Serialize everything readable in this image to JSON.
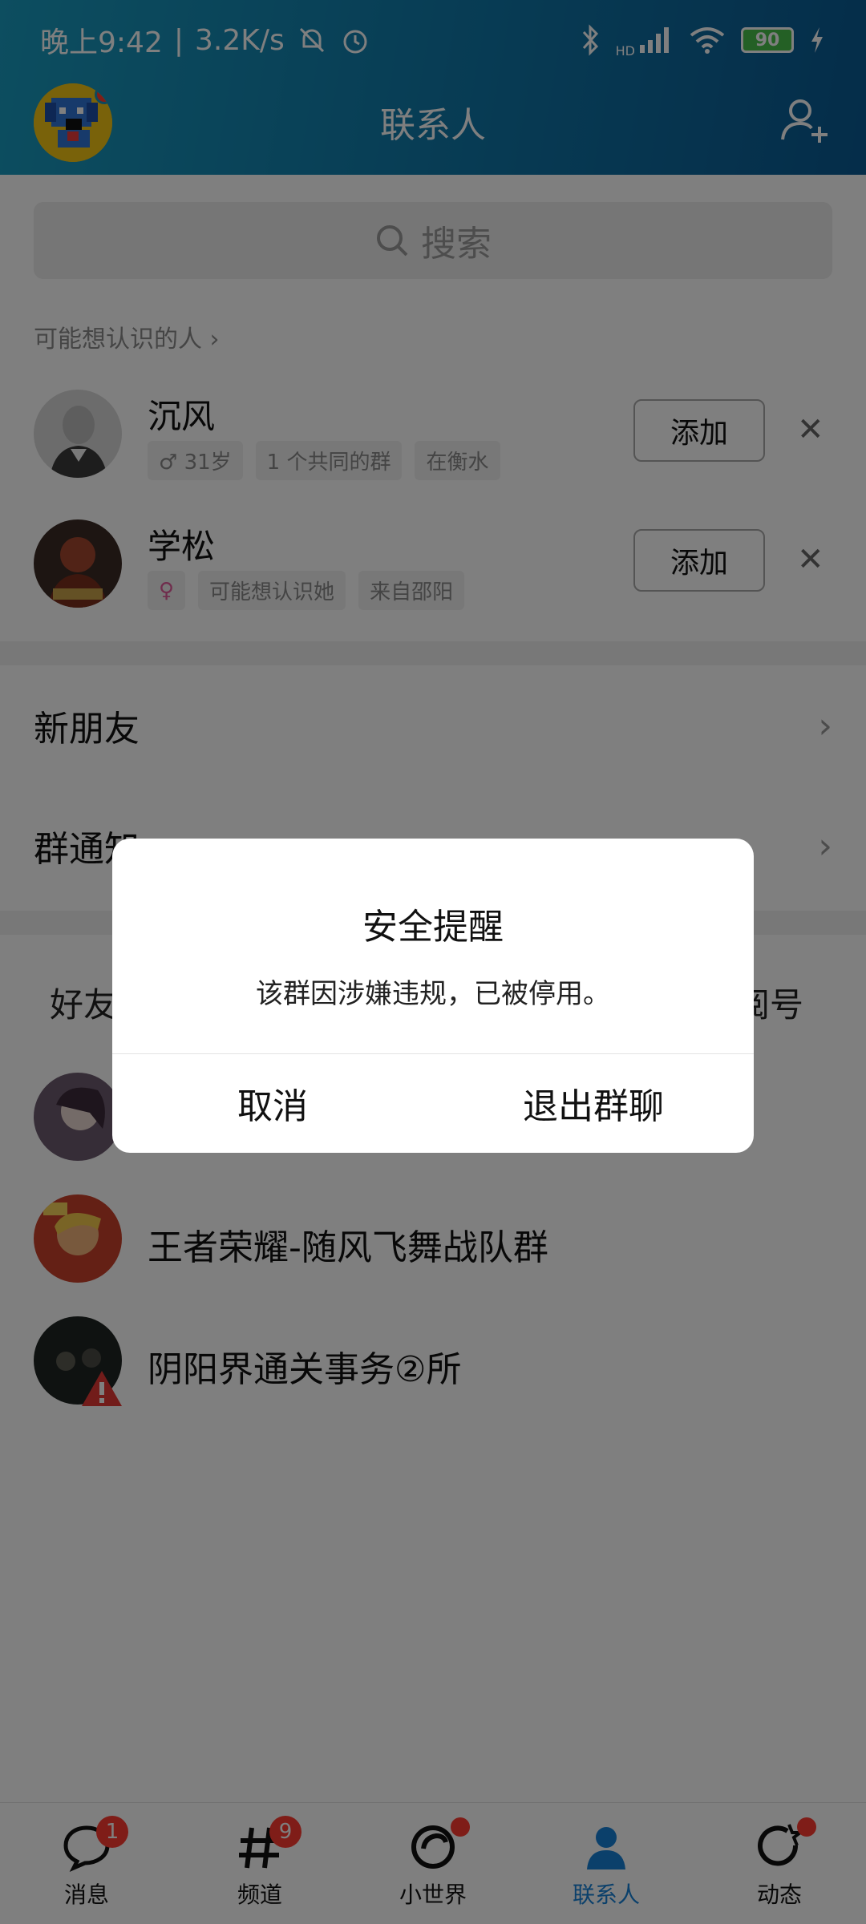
{
  "status_bar": {
    "time": "晚上9:42",
    "separator": "|",
    "net_speed": "3.2K/s",
    "battery": "90",
    "signal_label": "HD"
  },
  "header": {
    "title": "联系人"
  },
  "search": {
    "placeholder": "搜索"
  },
  "suggest": {
    "heading": "可能想认识的人",
    "people": [
      {
        "name": "沉风",
        "tags": [
          "♂ 31岁",
          "1 个共同的群",
          "在衡水"
        ],
        "button": "添加"
      },
      {
        "name": "学松",
        "tags": [
          "♀",
          "可能想认识她",
          "来自邵阳"
        ],
        "button": "添加"
      }
    ]
  },
  "rows": {
    "new_friends": "新朋友",
    "group_notice": "群通知"
  },
  "tabs": {
    "friends": "好友",
    "right_partial": "阅号"
  },
  "groups": [
    {
      "name": ""
    },
    {
      "name": "王者荣耀-随风飞舞战队群"
    },
    {
      "name": "阴阳界通关事务②所"
    }
  ],
  "bottom_nav": [
    {
      "label": "消息",
      "badge": "1"
    },
    {
      "label": "频道",
      "badge": "9"
    },
    {
      "label": "小世界",
      "badge": ""
    },
    {
      "label": "联系人",
      "badge": ""
    },
    {
      "label": "动态",
      "badge": ""
    }
  ],
  "dialog": {
    "title": "安全提醒",
    "message": "该群因涉嫌违规，已被停用。",
    "cancel": "取消",
    "confirm": "退出群聊"
  },
  "colors": {
    "header_start": "#1a9cc0",
    "header_end": "#0a5a93",
    "active_nav": "#1680d6",
    "badge": "#ff3b30"
  }
}
